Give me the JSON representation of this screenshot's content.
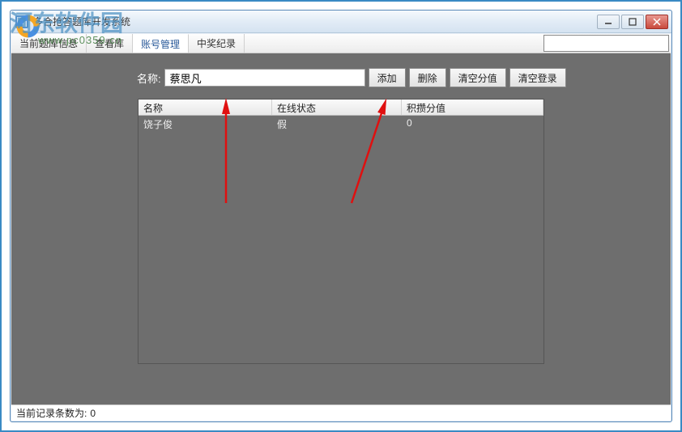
{
  "watermark": {
    "brand": "河东软件园",
    "url": "www.pc0359.cn"
  },
  "window": {
    "title": "多合抢答题库开发系统",
    "controls": {
      "min": "minimize",
      "max": "maximize",
      "close": "close"
    }
  },
  "tabs": [
    {
      "label": "当前题库信息"
    },
    {
      "label": "查看库"
    },
    {
      "label": "账号管理",
      "active": true
    },
    {
      "label": "中奖纪录"
    }
  ],
  "form": {
    "name_label": "名称:",
    "name_value": "蔡思凡",
    "buttons": {
      "add": "添加",
      "delete": "删除",
      "clear_score": "清空分值",
      "clear_login": "清空登录"
    }
  },
  "grid": {
    "columns": {
      "name": "名称",
      "status": "在线状态",
      "score": "积攒分值"
    },
    "rows": [
      {
        "name": "饶子俊",
        "status": "假",
        "score": "0"
      }
    ]
  },
  "status": {
    "label": "当前记录条数为:",
    "value": "0"
  }
}
